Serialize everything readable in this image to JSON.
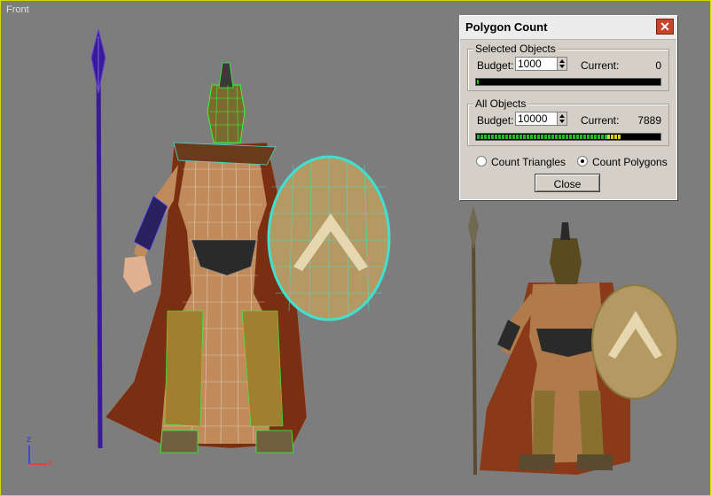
{
  "viewport": {
    "label": "Front"
  },
  "dialog": {
    "title": "Polygon Count",
    "close_glyph": "✕",
    "selected": {
      "legend": "Selected Objects",
      "budget_label": "Budget:",
      "budget_value": "1000",
      "current_label": "Current:",
      "current_value": "0",
      "fill_fraction": 0.01
    },
    "all": {
      "legend": "All Objects",
      "budget_label": "Budget:",
      "budget_value": "10000",
      "current_label": "Current:",
      "current_value": "7889",
      "fill_fraction": 0.79
    },
    "radio_triangles": "Count Triangles",
    "radio_polygons": "Count Polygons",
    "selected_mode": "polygons",
    "close_label": "Close"
  },
  "axis": {
    "z": "z",
    "x": "x"
  },
  "colors": {
    "viewport_border": "#d8d800",
    "wire_cyan": "#40e0d0",
    "wire_green": "#30ff30",
    "spear_purple": "#3a1a9a",
    "progress_green": "#20c020",
    "progress_yellow": "#e0d020"
  }
}
